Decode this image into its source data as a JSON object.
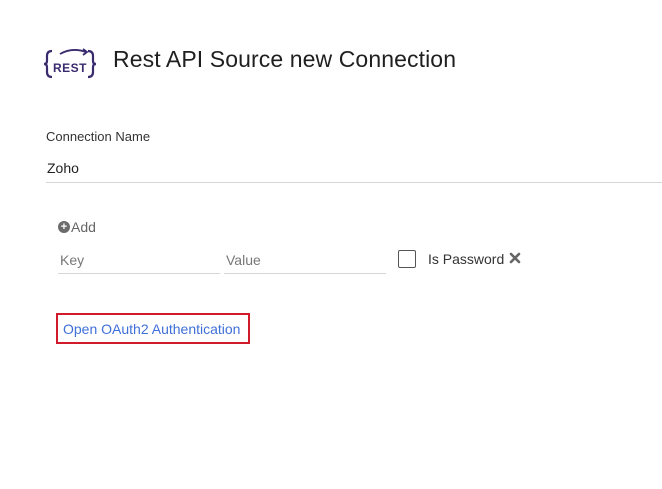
{
  "header": {
    "logo_text": "REST",
    "title": "Rest API Source new Connection"
  },
  "connection": {
    "label": "Connection Name",
    "value": "Zoho"
  },
  "params": {
    "add_label": "Add",
    "key_placeholder": "Key",
    "value_placeholder": "Value",
    "is_password_label": "Is Password",
    "is_password_checked": false
  },
  "oauth": {
    "link_label": "Open OAuth2 Authentication",
    "highlight_color": "#d11b2a"
  },
  "colors": {
    "link": "#3f6fd8",
    "logo": "#3a2a6e"
  }
}
